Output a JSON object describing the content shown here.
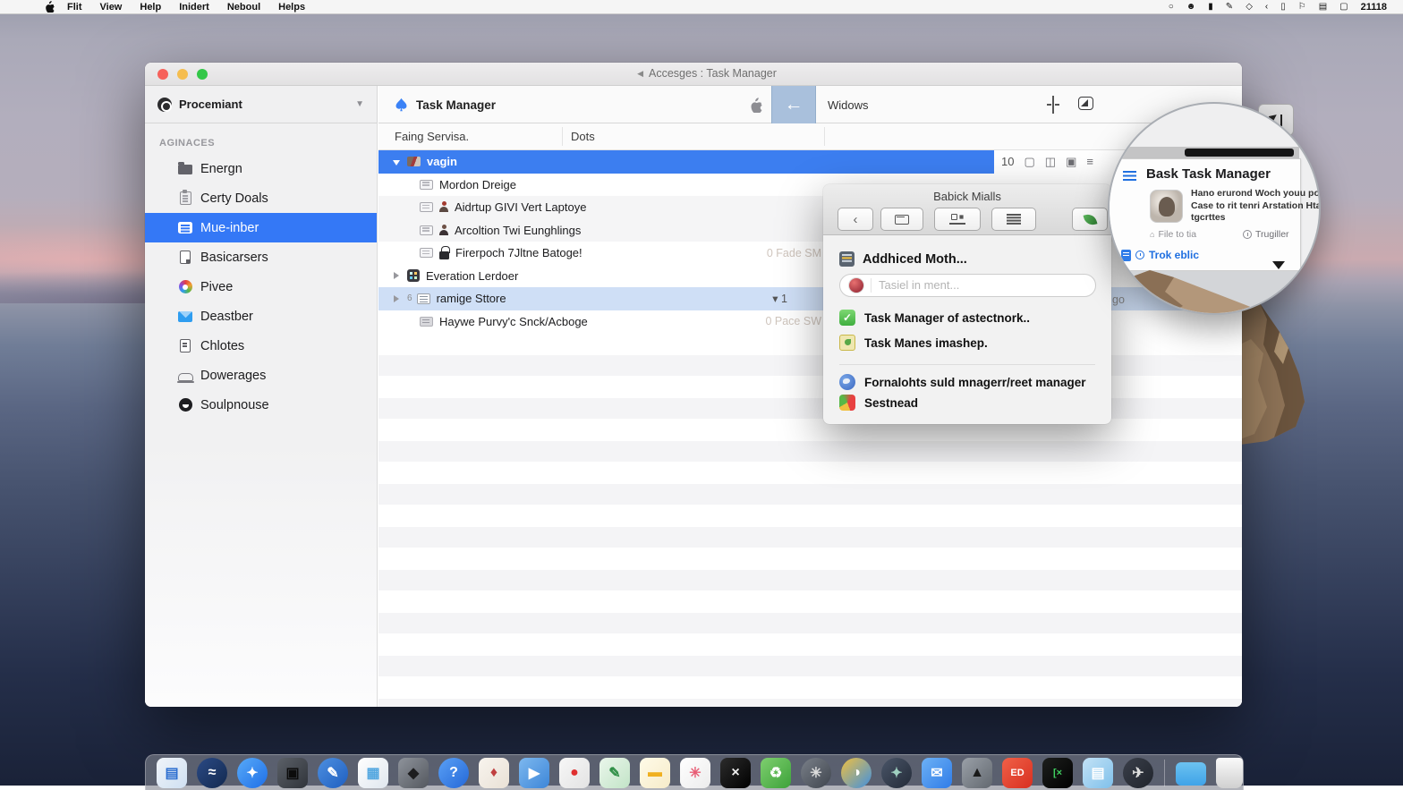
{
  "menu_bar": {
    "items": [
      "Flit",
      "View",
      "Help",
      "Inidert",
      "Neboul",
      "Helps"
    ],
    "status_icons": [
      {
        "name": "hotspot-icon",
        "glyph": "○"
      },
      {
        "name": "user-icon",
        "glyph": "☻"
      },
      {
        "name": "book-icon",
        "glyph": "▮"
      },
      {
        "name": "search-icon",
        "glyph": "✎"
      },
      {
        "name": "location-icon",
        "glyph": "◇"
      },
      {
        "name": "control-icon",
        "glyph": "‹"
      },
      {
        "name": "phone-icon",
        "glyph": "▯"
      },
      {
        "name": "flag-icon",
        "glyph": "⚐"
      },
      {
        "name": "display-icon",
        "glyph": "▤"
      },
      {
        "name": "battery-icon",
        "glyph": "▢"
      }
    ],
    "time": "21118"
  },
  "window": {
    "title": "Accesges : Task Manager",
    "sidebar": {
      "source_label": "Procemiant",
      "section_label": "AGINACES",
      "items": [
        {
          "label": "Energn",
          "icon": "folder-icon"
        },
        {
          "label": "Certy Doals",
          "icon": "clipboard-icon"
        },
        {
          "label": "Mue-inber",
          "icon": "list-icon",
          "selected": true
        },
        {
          "label": "Basicarsers",
          "icon": "document-icon"
        },
        {
          "label": "Pivee",
          "icon": "pinwheel-icon"
        },
        {
          "label": "Deastber",
          "icon": "mail-icon"
        },
        {
          "label": "Chlotes",
          "icon": "document-lines-icon"
        },
        {
          "label": "Dowerages",
          "icon": "car-icon"
        },
        {
          "label": "Soulpnouse",
          "icon": "ball-icon"
        }
      ]
    },
    "toolbar": {
      "app_title": "Task Manager",
      "back_arrow": "←",
      "nav_label": "Widows"
    },
    "list": {
      "columns": [
        "Faing Servisa.",
        "Dots"
      ],
      "selection_count": "10",
      "rows": [
        {
          "label": "vagin",
          "kind": "parent-selected",
          "icons": [
            "photo-icon"
          ],
          "disclosure": "open"
        },
        {
          "label": "Mordon Dreige",
          "kind": "child",
          "icons": [
            "window-icon"
          ]
        },
        {
          "label": "Aidrtup GIVI Vert Laptoye",
          "kind": "child-alt",
          "icons": [
            "window-icon",
            "person-red-icon"
          ]
        },
        {
          "label": "Arcoltion Twi Eunghlings",
          "kind": "child-alt",
          "icons": [
            "window-icon",
            "person-dark-icon"
          ]
        },
        {
          "label": "Firerpoch 7Jltne Batoge!",
          "kind": "child",
          "icons": [
            "window-icon",
            "lock-icon"
          ],
          "detail": "0 Fade SM"
        },
        {
          "label": "Everation Lerdoer",
          "kind": "parent",
          "icons": [
            "grid-icon"
          ],
          "disclosure": "closed"
        },
        {
          "label": "ramige Sttore",
          "kind": "highlight",
          "icons": [
            "list-small-icon"
          ],
          "disclosure": "closed",
          "badge": "▾ 1",
          "overflow_text": "go",
          "mini": "6"
        },
        {
          "label": "Haywe Purvy'c Snck/Acboge",
          "kind": "child",
          "icons": [
            "card-icon"
          ],
          "detail": "0 Pace SW"
        }
      ]
    }
  },
  "popup": {
    "title": "Babick Mialls",
    "section_label": "Addhiced Moth...",
    "search_placeholder": "Tasiel in ment...",
    "items_group1": [
      {
        "label": "Task Manager of astectnork..",
        "icon": "check-icon"
      },
      {
        "label": "Task Manes imashep.",
        "icon": "palm-icon"
      }
    ],
    "items_group2": [
      {
        "label": "Fornalohts suld mnagerr/reet manager",
        "icon": "globe-icon"
      },
      {
        "label": "Sestnead",
        "icon": "color-icon"
      }
    ]
  },
  "magnifier": {
    "card_title": "Bask Task Manager",
    "body_line1": "Hano erurond Woch youu pot Ihoj",
    "body_line2": "Case to rit tenri Arstation Htaa",
    "body_line3": "tgcrttes",
    "meta_left": "File to tia",
    "meta_right": "Trugiller",
    "link_label": "Trok eblic"
  },
  "colors": {
    "accent_blue": "#3478f6",
    "selection_row_blue": "#3c7ef0",
    "highlight_row_blue": "#cfdff6",
    "back_button_blue": "#a9c0dc"
  },
  "dock": {
    "icons": [
      {
        "name": "finder-icon",
        "shape": "square",
        "c1": "#f0f4f9",
        "c2": "#cfe0f2",
        "glyph": "▤",
        "gc": "#2d6fd0"
      },
      {
        "name": "siri-icon",
        "shape": "circle",
        "c1": "#2b4a85",
        "c2": "#12294f",
        "glyph": "≈",
        "gc": "#ffffff"
      },
      {
        "name": "safari-icon",
        "shape": "circle",
        "c1": "#58aaf8",
        "c2": "#1e6fe8",
        "glyph": "✦",
        "gc": "#ffffff"
      },
      {
        "name": "preview-icon",
        "shape": "square",
        "c1": "#5b6068",
        "c2": "#30343a",
        "glyph": "▣",
        "gc": "#0c0c0c"
      },
      {
        "name": "pen-app-icon",
        "shape": "circle",
        "c1": "#4d8fe0",
        "c2": "#1f5fc0",
        "glyph": "✎",
        "gc": "#ffffff"
      },
      {
        "name": "media-grid-icon",
        "shape": "square",
        "c1": "#ffffff",
        "c2": "#dfe6ee",
        "glyph": "▦",
        "gc": "#53a7e0"
      },
      {
        "name": "bottle-icon",
        "shape": "square",
        "c1": "#8e939b",
        "c2": "#54585f",
        "glyph": "◆",
        "gc": "#1d1d1f"
      },
      {
        "name": "help-icon",
        "shape": "circle",
        "c1": "#5aa0f5",
        "c2": "#2468d8",
        "glyph": "?",
        "gc": "#ffffff"
      },
      {
        "name": "cards-icon",
        "shape": "square",
        "c1": "#f8f4ee",
        "c2": "#e9e1d6",
        "glyph": "♦",
        "gc": "#c04040"
      },
      {
        "name": "bird-icon",
        "shape": "square",
        "c1": "#7db8ef",
        "c2": "#3d86d8",
        "glyph": "▶",
        "gc": "#ffffff"
      },
      {
        "name": "pingpong-icon",
        "shape": "square",
        "c1": "#f7f7f7",
        "c2": "#e3e3e3",
        "glyph": "●",
        "gc": "#e03030"
      },
      {
        "name": "tools-icon",
        "shape": "square",
        "c1": "#eaf6eb",
        "c2": "#c2e4c7",
        "glyph": "✎",
        "gc": "#2f8f46"
      },
      {
        "name": "notes-icon",
        "shape": "square",
        "c1": "#fffbe8",
        "c2": "#f6ebc9",
        "glyph": "▬",
        "gc": "#f0b020"
      },
      {
        "name": "photos-icon",
        "shape": "square",
        "c1": "#ffffff",
        "c2": "#ececec",
        "glyph": "✳",
        "gc": "#e85d75"
      },
      {
        "name": "x-app-icon",
        "shape": "square",
        "c1": "#2c2c2c",
        "c2": "#000000",
        "glyph": "×",
        "gc": "#eeeeee"
      },
      {
        "name": "recycle-icon",
        "shape": "square",
        "c1": "#7ecf6f",
        "c2": "#3da23a",
        "glyph": "♻",
        "gc": "#ffffff"
      },
      {
        "name": "gear-icon",
        "shape": "circle",
        "c1": "#7a8089",
        "c2": "#3f454e",
        "glyph": "✳",
        "gc": "#dddddd"
      },
      {
        "name": "browser-icon",
        "shape": "circle",
        "c1": "#f0c040",
        "c2": "#4090e0",
        "glyph": "◑",
        "gc": "#ffffff"
      },
      {
        "name": "feather-icon",
        "shape": "circle",
        "c1": "#4a5568",
        "c2": "#232b38",
        "glyph": "✦",
        "gc": "#9fd0c0"
      },
      {
        "name": "mail-app-icon",
        "shape": "square",
        "c1": "#6db1f5",
        "c2": "#2f7ce8",
        "glyph": "✉",
        "gc": "#ffffff"
      },
      {
        "name": "dark-tri-icon",
        "shape": "square",
        "c1": "#9aa0a8",
        "c2": "#62686f",
        "glyph": "▲",
        "gc": "#1a1a1a"
      },
      {
        "name": "red-ed-icon",
        "shape": "square",
        "c1": "#f06048",
        "c2": "#d83020",
        "glyph": "ED",
        "gc": "#ffffff"
      },
      {
        "name": "terminal-icon",
        "shape": "square",
        "c1": "#1d1f1d",
        "c2": "#000000",
        "glyph": "[×",
        "gc": "#40d060"
      },
      {
        "name": "docs-icon",
        "shape": "square",
        "c1": "#c3e2f6",
        "c2": "#7fc0ea",
        "glyph": "▤",
        "gc": "#ffffff"
      },
      {
        "name": "compass-icon",
        "shape": "circle",
        "c1": "#3a3f4a",
        "c2": "#20242c",
        "glyph": "✈",
        "gc": "#dddddd"
      }
    ]
  }
}
